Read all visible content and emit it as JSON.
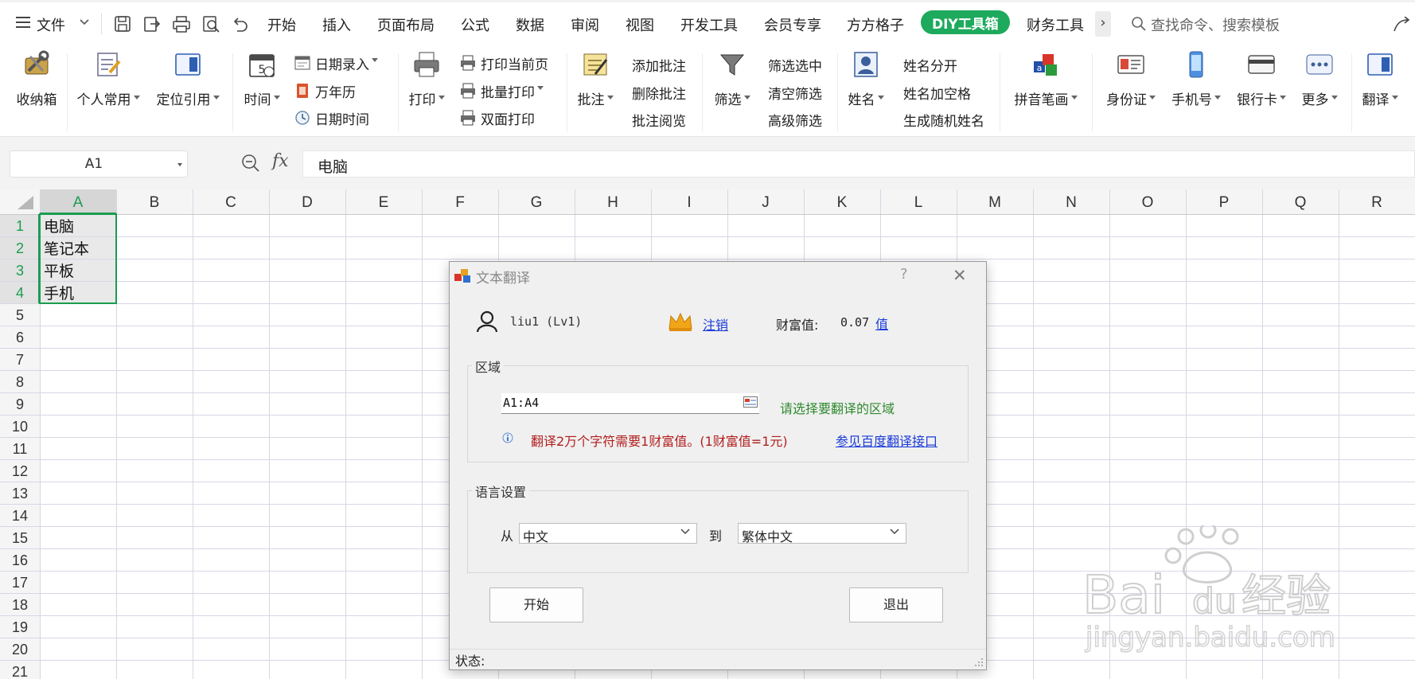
{
  "menubar": {
    "file_label": "文件",
    "tabs": [
      "开始",
      "插入",
      "页面布局",
      "公式",
      "数据",
      "审阅",
      "视图",
      "开发工具",
      "会员专享",
      "方方格子",
      "DIY工具箱",
      "财务工具"
    ],
    "active_tab": "DIY工具箱",
    "search_placeholder": "查找命令、搜索模板",
    "more_arrow": "›",
    "accent_color": "#1daa5c"
  },
  "ribbon": {
    "favorites": "收纳箱",
    "personal": "个人常用",
    "locate_ref": "定位引用",
    "time": "时间",
    "date_entry": "日期录入",
    "calendar": "万年历",
    "datetime": "日期时间",
    "print": "打印",
    "print_current": "打印当前页",
    "batch_print": "批量打印",
    "duplex_print": "双面打印",
    "comment": "批注",
    "add_comment": "添加批注",
    "delete_comment": "删除批注",
    "view_comment": "批注阅览",
    "filter": "筛选",
    "filter_selected": "筛选选中",
    "clear_filter": "清空筛选",
    "advanced_filter": "高级筛选",
    "name": "姓名",
    "split_name": "姓名分开",
    "name_space": "姓名加空格",
    "random_name": "生成随机姓名",
    "pinyin": "拼音笔画",
    "id_card": "身份证",
    "phone": "手机号",
    "bank_card": "银行卡",
    "more": "更多",
    "translate": "翻译"
  },
  "formula_bar": {
    "cell_ref": "A1",
    "fx": "fx",
    "value": "电脑"
  },
  "sheet": {
    "columns": [
      "A",
      "B",
      "C",
      "D",
      "E",
      "F",
      "G",
      "H",
      "I",
      "J",
      "K",
      "L",
      "M",
      "N",
      "O",
      "P",
      "Q",
      "R"
    ],
    "rows": [
      "1",
      "2",
      "3",
      "4",
      "5",
      "6",
      "7",
      "8",
      "9",
      "10",
      "11",
      "12",
      "13",
      "14",
      "15",
      "16",
      "17",
      "18",
      "19",
      "20",
      "21"
    ],
    "cells": [
      "电脑",
      "笔记本",
      "平板",
      "手机"
    ],
    "selection_color": "#1a9d50"
  },
  "dialog": {
    "title": "文本翻译",
    "help": "?",
    "close": "✕",
    "user": "liu1 (Lv1)",
    "logout": "注销",
    "wealth_label": "财富值:",
    "wealth_value": "0.07",
    "recharge": "值",
    "range_legend": "区域",
    "range_value": "A1:A4",
    "range_hint": "请选择要翻译的区域",
    "info_text": "翻译2万个字符需要1财富值。(1财富值=1元)",
    "info_link": "参见百度翻译接口",
    "lang_legend": "语言设置",
    "from_label": "从",
    "from_value": "中文",
    "to_label": "到",
    "to_value": "繁体中文",
    "start_button": "开始",
    "exit_button": "退出",
    "status_label": "状态:"
  },
  "watermark": {
    "brand": "Bai",
    "brand_mid": "du",
    "product": "经验",
    "url": "jingyan.baidu.com"
  }
}
